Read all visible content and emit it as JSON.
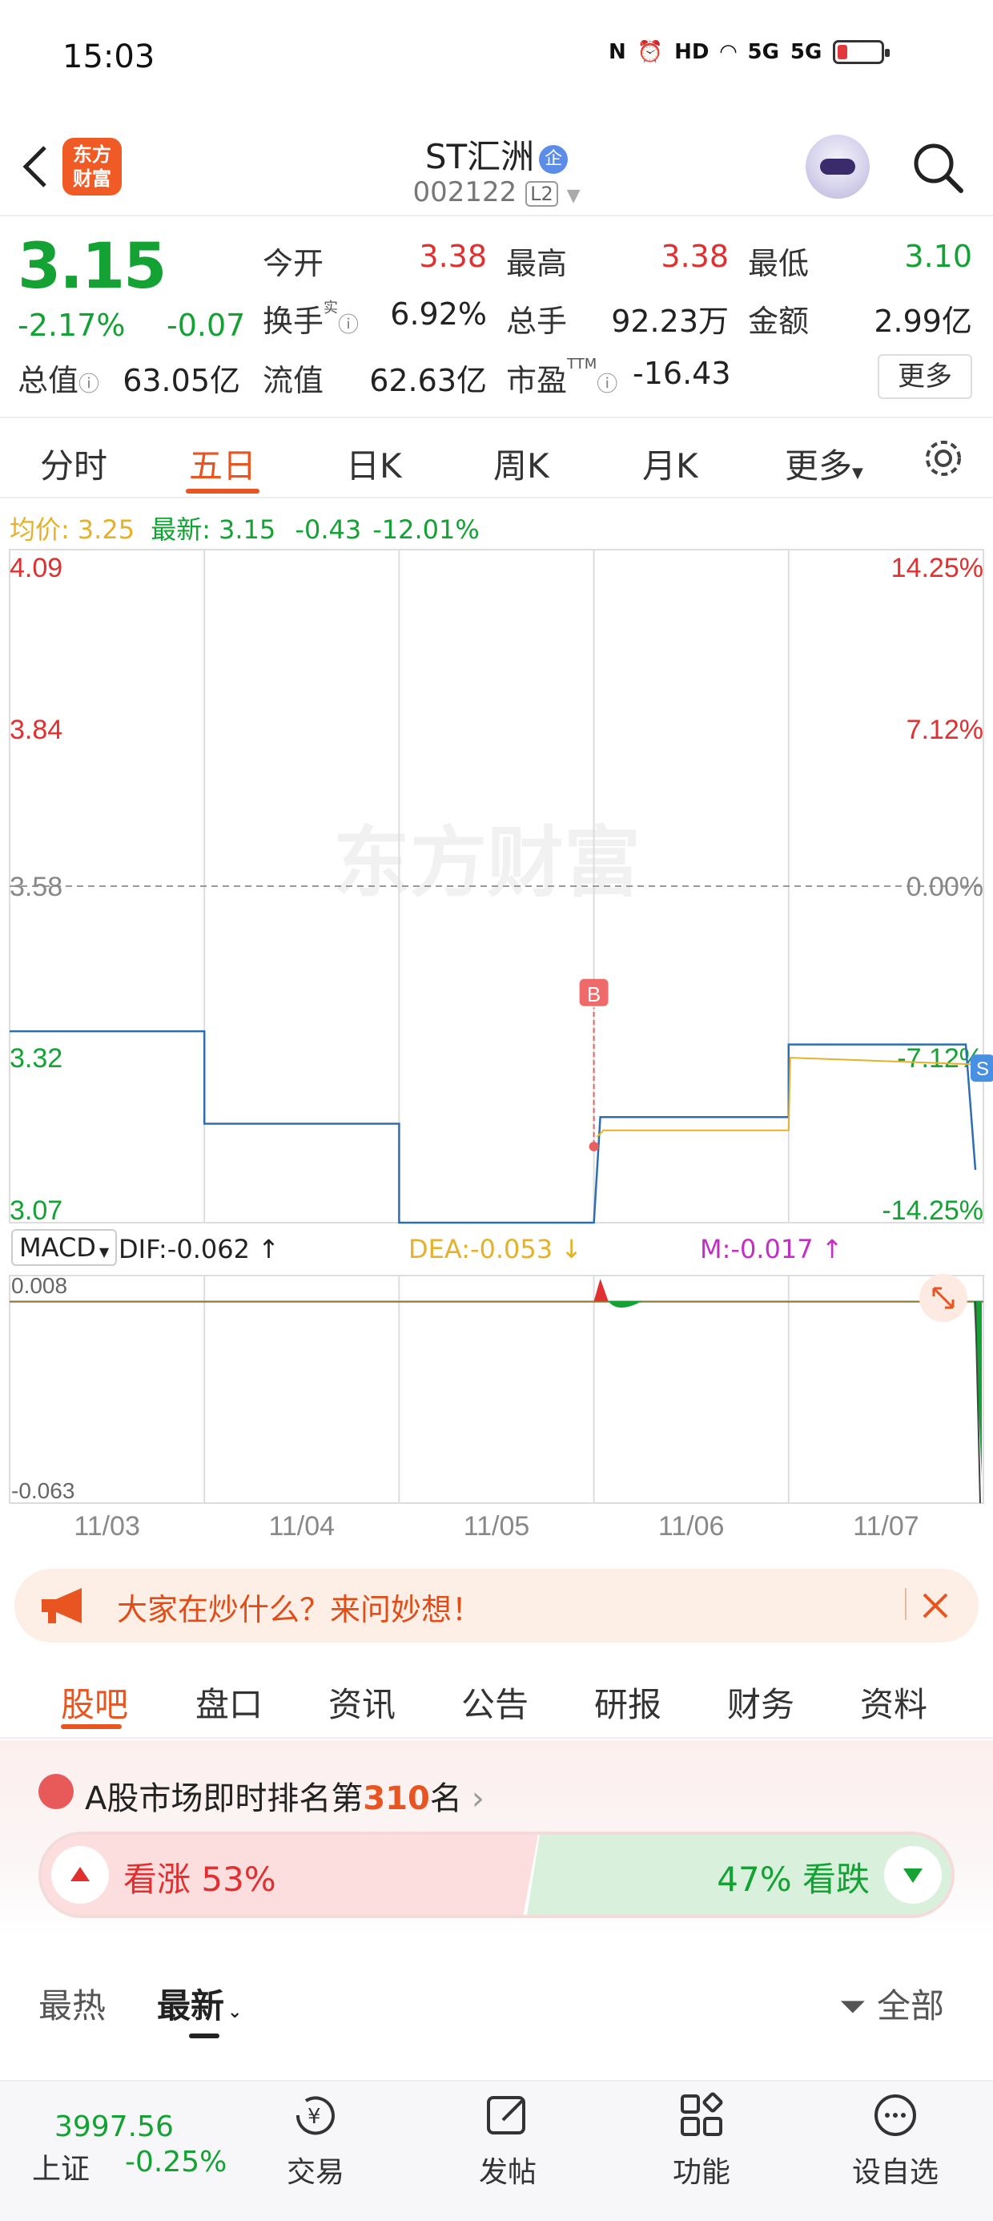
{
  "status_bar": {
    "time": "15:03",
    "network": "5G"
  },
  "header": {
    "app_logo": "东方\n财富",
    "stock_name": "ST汇洲",
    "enterprise_badge": "企",
    "stock_code": "002122",
    "level_badge": "L2"
  },
  "quote": {
    "price": "3.15",
    "change_pct": "-2.17%",
    "change": "-0.07",
    "open_label": "今开",
    "open": "3.38",
    "high_label": "最高",
    "high": "3.38",
    "low_label": "最低",
    "low": "3.10",
    "turnover_label": "换手",
    "turnover_sup": "实",
    "turnover": "6.92%",
    "volume_label": "总手",
    "volume": "92.23万",
    "amount_label": "金额",
    "amount": "2.99亿",
    "mcap_label": "总值",
    "mcap": "63.05亿",
    "float_label": "流值",
    "float": "62.63亿",
    "pe_label": "市盈",
    "pe_sup": "TTM",
    "pe": "-16.43",
    "more_label": "更多"
  },
  "chart_tabs": [
    "分时",
    "五日",
    "日K",
    "周K",
    "月K",
    "更多"
  ],
  "chart_tabs_active": "五日",
  "avg_line": {
    "avg_label": "均价:",
    "avg": "3.25",
    "latest_label": "最新:",
    "latest": "3.15",
    "latest_chg": "-0.43",
    "latest_pct": "-12.01%"
  },
  "chart_data": {
    "type": "line",
    "days": [
      "11/03",
      "11/04",
      "11/05",
      "11/06",
      "11/07"
    ],
    "prev_close": 3.58,
    "ylim": [
      3.07,
      4.09
    ],
    "y_tick_labels_left": [
      "4.09",
      "3.84",
      "3.58",
      "3.32",
      "3.07"
    ],
    "y_tick_labels_right": [
      "14.25%",
      "7.12%",
      "0.00%",
      "-7.12%",
      "-14.25%"
    ],
    "series": [
      {
        "values": [
          3.36,
          3.36,
          3.22,
          3.22,
          3.07,
          3.07,
          3.15,
          3.23,
          3.23,
          3.34,
          3.34,
          3.15
        ]
      },
      {
        "values": [
          3.2,
          3.21,
          3.21,
          3.32,
          3.31
        ]
      }
    ],
    "markers": [
      {
        "label": "B",
        "day": "11/06",
        "price": 3.2
      },
      {
        "label": "S",
        "day": "11/07",
        "price": 3.32
      }
    ],
    "macd": {
      "selector": "MACD",
      "dif_label": "DIF:-0.062",
      "dea_label": "DEA:-0.053",
      "m_label": "M:-0.017",
      "y_max": "0.008",
      "y_min": "-0.063",
      "range": [
        -0.063,
        0.008
      ]
    }
  },
  "promo": {
    "text": "大家在炒什么？来问妙想！"
  },
  "bottom_tabs": [
    "股吧",
    "盘口",
    "资讯",
    "公告",
    "研报",
    "财务",
    "资料"
  ],
  "bottom_tabs_active": "股吧",
  "ranking": {
    "prefix": "A股市场即时排名第",
    "rank": "310",
    "suffix": "名"
  },
  "sentiment": {
    "up_label": "看涨 53%",
    "down_label": "47% 看跌",
    "up": 0.53,
    "down": 0.47
  },
  "sort": {
    "hot": "最热",
    "latest": "最新",
    "filter": "全部"
  },
  "index": {
    "value": "3997.56",
    "name": "上证",
    "change": "-0.25%"
  },
  "nav": {
    "trade": "交易",
    "post": "发帖",
    "functions": "功能",
    "watchlist": "设自选"
  },
  "colors": {
    "up": "#e03030",
    "down": "#13a233",
    "accent": "#e85520",
    "price_line": "#2f6db3",
    "avg_line": "#e6b12a"
  }
}
